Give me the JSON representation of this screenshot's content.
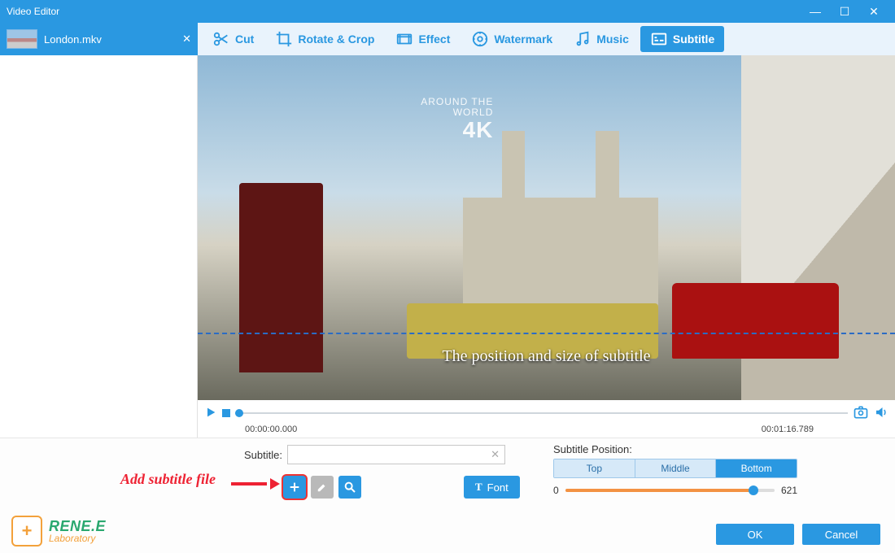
{
  "window": {
    "title": "Video Editor"
  },
  "file": {
    "name": "London.mkv"
  },
  "toolbar": {
    "cut": "Cut",
    "rotate": "Rotate & Crop",
    "effect": "Effect",
    "watermark": "Watermark",
    "music": "Music",
    "subtitle": "Subtitle",
    "active": "subtitle"
  },
  "preview": {
    "watermark_line1": "AROUND THE",
    "watermark_line2": "WORLD",
    "watermark_big": "4K",
    "subtitle_overlay": "The position and size of subtitle"
  },
  "timeline": {
    "current": "00:00:00.000",
    "total": "00:01:16.789"
  },
  "subtitle_panel": {
    "label": "Subtitle:",
    "value": "",
    "font_button": "Font",
    "hint": "Add subtitle file"
  },
  "position_panel": {
    "label": "Subtitle Position:",
    "options": {
      "top": "Top",
      "middle": "Middle",
      "bottom": "Bottom"
    },
    "active": "bottom",
    "slider_min": "0",
    "slider_max": "621"
  },
  "logo": {
    "brand": "RENE.E",
    "sub": "Laboratory"
  },
  "dialog": {
    "ok": "OK",
    "cancel": "Cancel"
  }
}
